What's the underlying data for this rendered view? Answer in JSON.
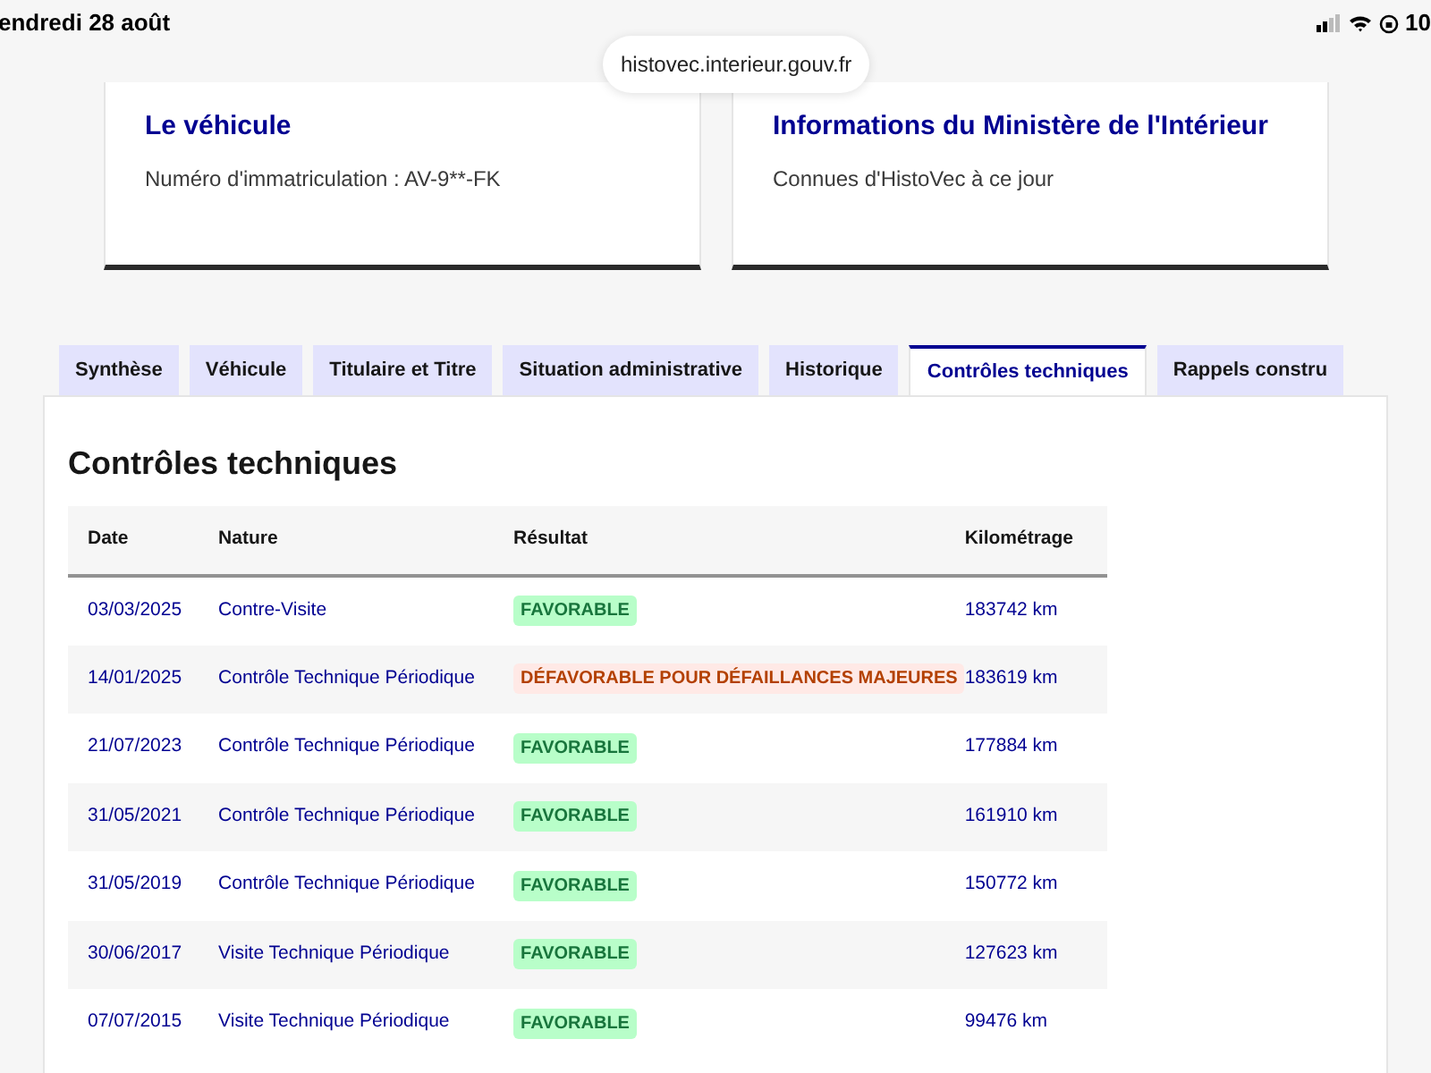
{
  "status_bar": {
    "date": "endredi 28 août",
    "battery": "10"
  },
  "url": "histovec.interieur.gouv.fr",
  "cards": [
    {
      "title": "Le véhicule",
      "subtitle": "Numéro d'immatriculation : AV-9**-FK"
    },
    {
      "title": "Informations du Ministère de l'Intérieur",
      "subtitle": "Connues d'HistoVec à ce jour"
    }
  ],
  "tabs": [
    {
      "label": "Synthèse",
      "selected": false
    },
    {
      "label": "Véhicule",
      "selected": false
    },
    {
      "label": "Titulaire et Titre",
      "selected": false
    },
    {
      "label": "Situation administrative",
      "selected": false
    },
    {
      "label": "Historique",
      "selected": false
    },
    {
      "label": "Contrôles techniques",
      "selected": true
    },
    {
      "label": "Rappels constru",
      "selected": false
    }
  ],
  "section_title": "Contrôles techniques",
  "table": {
    "columns": [
      "Date",
      "Nature",
      "Résultat",
      "Kilométrage"
    ],
    "rows": [
      {
        "date": "03/03/2025",
        "nature": "Contre-Visite",
        "result": {
          "text": "FAVORABLE",
          "kind": "favorable"
        },
        "km": "183742 km"
      },
      {
        "date": "14/01/2025",
        "nature": "Contrôle Technique Périodique",
        "result": {
          "text": "DÉFAVORABLE POUR DÉFAILLANCES MAJEURES",
          "kind": "defavorable"
        },
        "km": "183619 km"
      },
      {
        "date": "21/07/2023",
        "nature": "Contrôle Technique Périodique",
        "result": {
          "text": "FAVORABLE",
          "kind": "favorable"
        },
        "km": "177884 km"
      },
      {
        "date": "31/05/2021",
        "nature": "Contrôle Technique Périodique",
        "result": {
          "text": "FAVORABLE",
          "kind": "favorable"
        },
        "km": "161910 km"
      },
      {
        "date": "31/05/2019",
        "nature": "Contrôle Technique Périodique",
        "result": {
          "text": "FAVORABLE",
          "kind": "favorable"
        },
        "km": "150772 km"
      },
      {
        "date": "30/06/2017",
        "nature": "Visite Technique Périodique",
        "result": {
          "text": "FAVORABLE",
          "kind": "favorable"
        },
        "km": "127623 km"
      },
      {
        "date": "07/07/2015",
        "nature": "Visite Technique Périodique",
        "result": {
          "text": "FAVORABLE",
          "kind": "favorable"
        },
        "km": "99476 km"
      }
    ]
  }
}
